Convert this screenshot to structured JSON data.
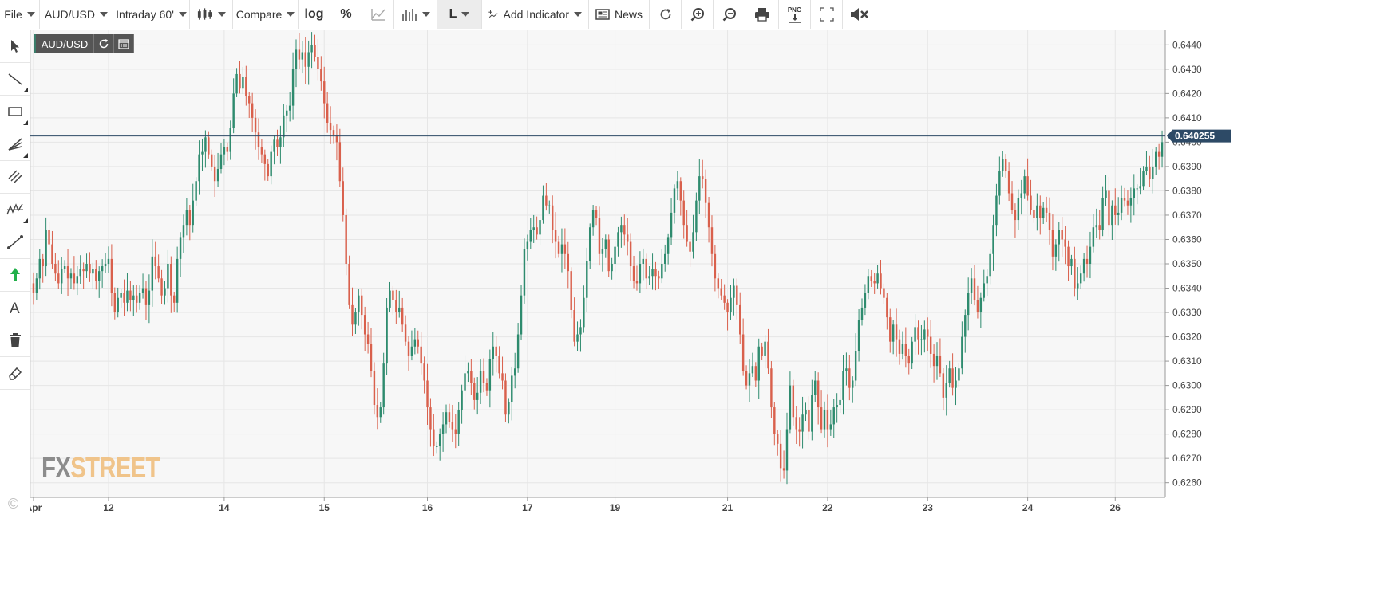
{
  "toolbar": {
    "file": "File",
    "symbol": "AUD/USD",
    "interval": "Intraday 60'",
    "compare": "Compare",
    "log": "log",
    "percent": "%",
    "line_style": "L",
    "add_indicator": "Add Indicator",
    "news": "News",
    "png": "PNG"
  },
  "header": {
    "symbol": "AUD/USD"
  },
  "logo": {
    "fx": "FX",
    "street": "STREET"
  },
  "copyright": "©",
  "colors": {
    "up": "#2e8b6e",
    "down": "#d9604c",
    "grid": "#e6e6e6",
    "price_line": "#2d4a66",
    "price_badge": "#2d4a66"
  },
  "chart_data": {
    "type": "candlestick",
    "title": "AUD/USD",
    "interval": "Intraday 60'",
    "current_price": "0.640255",
    "current_price_value": 0.640255,
    "ylim": [
      0.6254,
      0.6446
    ],
    "y_ticks": [
      "0.6440",
      "0.6430",
      "0.6420",
      "0.6410",
      "0.6400",
      "0.6390",
      "0.6380",
      "0.6370",
      "0.6360",
      "0.6350",
      "0.6340",
      "0.6330",
      "0.6320",
      "0.6310",
      "0.6300",
      "0.6290",
      "0.6280",
      "0.6270",
      "0.6260"
    ],
    "x_ticks": [
      {
        "label": "Apr",
        "index": 0
      },
      {
        "label": "12",
        "index": 24
      },
      {
        "label": "14",
        "index": 61
      },
      {
        "label": "15",
        "index": 93
      },
      {
        "label": "16",
        "index": 126
      },
      {
        "label": "17",
        "index": 158
      },
      {
        "label": "19",
        "index": 186
      },
      {
        "label": "21",
        "index": 222
      },
      {
        "label": "22",
        "index": 254
      },
      {
        "label": "23",
        "index": 286
      },
      {
        "label": "24",
        "index": 318
      },
      {
        "label": "26",
        "index": 346
      }
    ],
    "close": [
      0.6338,
      0.6344,
      0.6352,
      0.6349,
      0.6364,
      0.6358,
      0.635,
      0.6346,
      0.6342,
      0.6348,
      0.6349,
      0.6344,
      0.6346,
      0.6342,
      0.6345,
      0.6348,
      0.6347,
      0.635,
      0.6346,
      0.6348,
      0.6343,
      0.6347,
      0.6349,
      0.635,
      0.6352,
      0.6338,
      0.633,
      0.6336,
      0.6338,
      0.6334,
      0.6339,
      0.6335,
      0.6337,
      0.6334,
      0.6338,
      0.634,
      0.6333,
      0.6339,
      0.6353,
      0.6349,
      0.6344,
      0.6337,
      0.634,
      0.635,
      0.6337,
      0.6334,
      0.6352,
      0.6361,
      0.6366,
      0.6372,
      0.6366,
      0.6376,
      0.6384,
      0.6395,
      0.6396,
      0.6402,
      0.6395,
      0.639,
      0.6384,
      0.6389,
      0.6395,
      0.6398,
      0.6396,
      0.6406,
      0.642,
      0.6428,
      0.6422,
      0.6427,
      0.6419,
      0.6416,
      0.641,
      0.6404,
      0.6398,
      0.6395,
      0.6391,
      0.6386,
      0.6396,
      0.6401,
      0.6398,
      0.6402,
      0.6411,
      0.6413,
      0.6415,
      0.643,
      0.6438,
      0.6434,
      0.6437,
      0.6431,
      0.6437,
      0.644,
      0.6435,
      0.643,
      0.6425,
      0.6416,
      0.6408,
      0.6405,
      0.6403,
      0.64,
      0.6384,
      0.637,
      0.635,
      0.6333,
      0.6325,
      0.633,
      0.6337,
      0.6329,
      0.6321,
      0.6317,
      0.6306,
      0.6292,
      0.6287,
      0.6291,
      0.6309,
      0.6332,
      0.6339,
      0.6335,
      0.633,
      0.6332,
      0.6325,
      0.6318,
      0.6312,
      0.6316,
      0.6319,
      0.6316,
      0.6309,
      0.6302,
      0.6291,
      0.6282,
      0.6275,
      0.6275,
      0.628,
      0.6284,
      0.6289,
      0.6285,
      0.6282,
      0.628,
      0.629,
      0.6298,
      0.6305,
      0.6306,
      0.6301,
      0.6294,
      0.6297,
      0.6306,
      0.6301,
      0.6298,
      0.6311,
      0.6316,
      0.6312,
      0.6305,
      0.6302,
      0.6288,
      0.6293,
      0.6304,
      0.6307,
      0.6321,
      0.6337,
      0.6356,
      0.6359,
      0.6364,
      0.6365,
      0.6362,
      0.6368,
      0.6378,
      0.6374,
      0.6374,
      0.6364,
      0.6359,
      0.6354,
      0.6358,
      0.6354,
      0.6347,
      0.6331,
      0.6318,
      0.6321,
      0.6324,
      0.6336,
      0.6351,
      0.6365,
      0.6372,
      0.6369,
      0.6354,
      0.6356,
      0.636,
      0.6347,
      0.635,
      0.6357,
      0.6363,
      0.6366,
      0.6362,
      0.6359,
      0.6349,
      0.6343,
      0.6342,
      0.635,
      0.6352,
      0.6344,
      0.6345,
      0.6348,
      0.6345,
      0.6344,
      0.635,
      0.6354,
      0.6361,
      0.6371,
      0.6381,
      0.6384,
      0.6376,
      0.6366,
      0.6359,
      0.6355,
      0.6363,
      0.6376,
      0.6386,
      0.6385,
      0.6375,
      0.6365,
      0.6354,
      0.6344,
      0.634,
      0.6337,
      0.6334,
      0.633,
      0.6336,
      0.6341,
      0.6333,
      0.6321,
      0.6306,
      0.63,
      0.6305,
      0.6308,
      0.6302,
      0.6316,
      0.6312,
      0.6318,
      0.6307,
      0.6291,
      0.628,
      0.6276,
      0.6266,
      0.6265,
      0.6282,
      0.63,
      0.6287,
      0.6282,
      0.6281,
      0.6288,
      0.629,
      0.6281,
      0.6296,
      0.6302,
      0.6291,
      0.6282,
      0.629,
      0.6282,
      0.6284,
      0.6291,
      0.6292,
      0.6294,
      0.6306,
      0.6307,
      0.6299,
      0.6302,
      0.6314,
      0.6327,
      0.6332,
      0.6338,
      0.6345,
      0.6343,
      0.6342,
      0.6346,
      0.634,
      0.6336,
      0.6328,
      0.6318,
      0.6325,
      0.6319,
      0.6313,
      0.6317,
      0.6312,
      0.6309,
      0.6318,
      0.6324,
      0.6319,
      0.6319,
      0.6323,
      0.632,
      0.6313,
      0.6308,
      0.6312,
      0.6305,
      0.6295,
      0.6301,
      0.6307,
      0.6299,
      0.6302,
      0.6307,
      0.632,
      0.6329,
      0.6338,
      0.6344,
      0.6335,
      0.633,
      0.6336,
      0.6342,
      0.6345,
      0.6354,
      0.6366,
      0.6378,
      0.6388,
      0.6393,
      0.6388,
      0.6379,
      0.6372,
      0.6368,
      0.6377,
      0.6379,
      0.6386,
      0.6378,
      0.6372,
      0.6369,
      0.6374,
      0.6369,
      0.6373,
      0.6371,
      0.6364,
      0.6353,
      0.6358,
      0.6364,
      0.636,
      0.6357,
      0.6349,
      0.6352,
      0.634,
      0.6342,
      0.6346,
      0.6352,
      0.635,
      0.6357,
      0.6365,
      0.6366,
      0.6364,
      0.6377,
      0.638,
      0.6366,
      0.6374,
      0.637,
      0.6371,
      0.6377,
      0.6376,
      0.6374,
      0.6377,
      0.6381,
      0.6381,
      0.6382,
      0.6388,
      0.639,
      0.6385,
      0.639,
      0.6396,
      0.6394,
      0.64
    ],
    "series": [
      {
        "name": "AUD/USD",
        "type": "candles"
      }
    ]
  }
}
